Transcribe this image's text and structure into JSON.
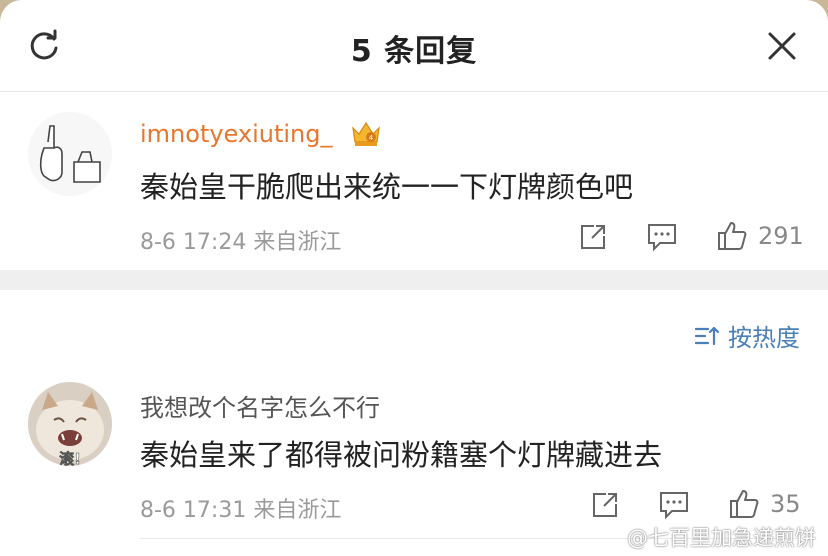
{
  "header": {
    "title": "5 条回复",
    "refresh_icon": "refresh-icon",
    "close_icon": "close-icon"
  },
  "comments": [
    {
      "username": "imnotyexiuting_",
      "badge": "crown-icon",
      "text": "秦始皇干脆爬出来统一一下灯牌颜色吧",
      "meta": "8-6 17:24 来自浙江",
      "likes": "291"
    },
    {
      "username": "我想改个名字怎么不行",
      "text": "秦始皇来了都得被问粉籍塞个灯牌藏进去",
      "meta": "8-6 17:31 来自浙江",
      "likes": "35",
      "avatar_caption": "滚!"
    }
  ],
  "sort": {
    "label": "按热度"
  },
  "watermark": "@七百里加急递煎饼",
  "colors": {
    "username_accent": "#e8762d",
    "link_blue": "#4a7fb7",
    "meta_gray": "#9a9a9a"
  }
}
